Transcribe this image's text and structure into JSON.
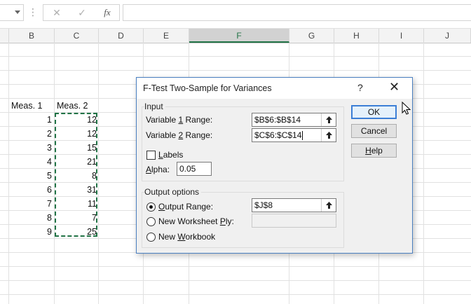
{
  "formula_bar": {
    "dots": "⋮",
    "cancel_glyph": "✕",
    "enter_glyph": "✓",
    "fx_label": "fx",
    "formula_value": ""
  },
  "sheet": {
    "columns": [
      "B",
      "C",
      "D",
      "E",
      "F",
      "G",
      "H",
      "I",
      "J"
    ],
    "selected_column": "F",
    "header_meas1": "Meas. 1",
    "header_meas2": "Meas. 2",
    "meas1": [
      "1",
      "2",
      "3",
      "4",
      "5",
      "6",
      "7",
      "8",
      "9"
    ],
    "meas2": [
      "12",
      "12",
      "15",
      "21",
      "8",
      "31",
      "11",
      "7",
      "25"
    ]
  },
  "dialog": {
    "title": "F-Test Two-Sample for Variances",
    "help_glyph": "?",
    "close_glyph": "✕",
    "input_group": "Input",
    "var1": {
      "pre": "Variable ",
      "key": "1",
      "post": " Range:",
      "value": "$B$6:$B$14"
    },
    "var2": {
      "pre": "Variable ",
      "key": "2",
      "post": " Range:",
      "value": "$C$6:$C$14"
    },
    "labels": {
      "key": "L",
      "rest": "abels",
      "checked": false
    },
    "alpha": {
      "key": "A",
      "rest": "lpha:",
      "value": "0.05"
    },
    "output_group": "Output options",
    "output_range": {
      "key": "O",
      "rest": "utput Range:",
      "value": "$J$8",
      "selected": true
    },
    "new_ply": {
      "pre": "New Worksheet ",
      "key": "P",
      "rest": "ly:",
      "value": ""
    },
    "new_workbook": {
      "pre": "New ",
      "key": "W",
      "rest": "orkbook"
    },
    "ok_label": "OK",
    "cancel_label": "Cancel",
    "help_label": {
      "key": "H",
      "rest": "elp"
    }
  },
  "colors": {
    "accent_green": "#217346",
    "dialog_border": "#4a7fc0",
    "default_button_border": "#3c7fd6"
  }
}
